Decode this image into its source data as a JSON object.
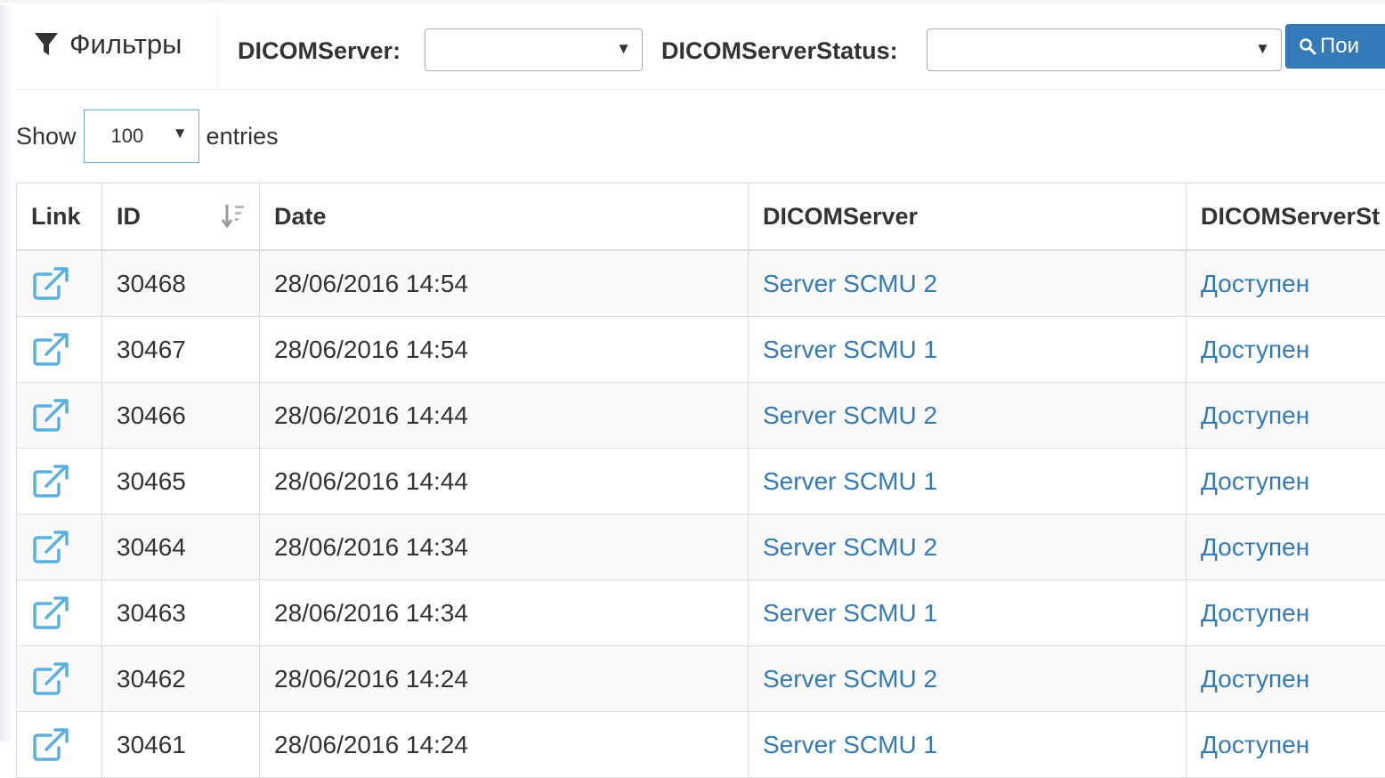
{
  "filters": {
    "title": "Фильтры",
    "dicom_server_label": "DICOMServer:",
    "dicom_server_value": "",
    "dicom_server_status_label": "DICOMServerStatus:",
    "dicom_server_status_value": "",
    "search_button_label": "Пои"
  },
  "length": {
    "show_label": "Show",
    "value": "100",
    "entries_label": "entries"
  },
  "table": {
    "columns": [
      "Link",
      "ID",
      "Date",
      "DICOMServer",
      "DICOMServerSt"
    ],
    "rows": [
      {
        "id": "30468",
        "date": "28/06/2016 14:54",
        "server": "Server SCMU 2",
        "status": "Доступен"
      },
      {
        "id": "30467",
        "date": "28/06/2016 14:54",
        "server": "Server SCMU 1",
        "status": "Доступен"
      },
      {
        "id": "30466",
        "date": "28/06/2016 14:44",
        "server": "Server SCMU 2",
        "status": "Доступен"
      },
      {
        "id": "30465",
        "date": "28/06/2016 14:44",
        "server": "Server SCMU 1",
        "status": "Доступен"
      },
      {
        "id": "30464",
        "date": "28/06/2016 14:34",
        "server": "Server SCMU 2",
        "status": "Доступен"
      },
      {
        "id": "30463",
        "date": "28/06/2016 14:34",
        "server": "Server SCMU 1",
        "status": "Доступен"
      },
      {
        "id": "30462",
        "date": "28/06/2016 14:24",
        "server": "Server SCMU 2",
        "status": "Доступен"
      },
      {
        "id": "30461",
        "date": "28/06/2016 14:24",
        "server": "Server SCMU 1",
        "status": "Доступен"
      }
    ]
  },
  "icons": {
    "filter": "filter-icon",
    "search": "search-icon",
    "sort": "sort-desc-icon",
    "row_link": "external-link-icon"
  },
  "colors": {
    "link": "#337ab7",
    "button": "#337ab7",
    "stripe": "#f9f9f9",
    "border": "#dddddd"
  }
}
